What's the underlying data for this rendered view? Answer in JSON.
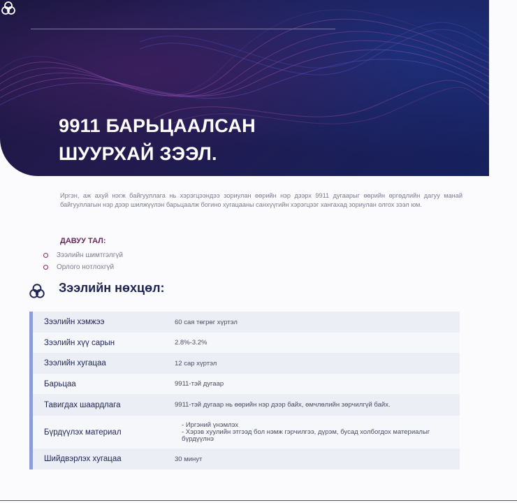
{
  "title_line1": "9911 БАРЬЦААЛСАН",
  "title_line2": "ШУУРХАЙ ЗЭЭЛ.",
  "intro": "Иргэн, аж ахуй нэгж байгууллага нь хэрэгцээндээ зориулан өөрийн нэр дээрх 9911 дугаарыг өөрийн өргөдлийн дагуу манай байгууллагын нэр дээр шилжүүлэн барьцаалж богино хугацааны санхүүгийн хэрэгцээг хангахад зориулан олгох зээл юм.",
  "advantages": {
    "heading": "ДАВУУ ТАЛ:",
    "items": [
      "Зээлийн шимтгэлгүй",
      "Орлого нотлохгүй"
    ]
  },
  "conditions": {
    "heading": "Зээлийн нөхцөл:",
    "rows": [
      {
        "label": "Зээлийн хэмжээ",
        "value": "60 сая төгрөг хүртэл"
      },
      {
        "label": "Зээлийн хүү сарын",
        "value": "2.8%-3.2%"
      },
      {
        "label": "Зээлийн хугацаа",
        "value": "12 сар хүртэл"
      },
      {
        "label": "Барьцаа",
        "value": "9911-тэй дугаар"
      },
      {
        "label": "Тавигдах шаардлага",
        "value": "9911-тэй дугаар нь өөрийн нэр дээр байх, өмчлөлийн зөрчилгүй байх."
      },
      {
        "label": "Бүрдүүлэх материал",
        "list": [
          "Иргэний үнэмлэх",
          "Хэрэв хуулийн этгээд бол нэмж гэрчилгээ, дүрэм, бусад холбогдох материалыг бүрдүүлнэ"
        ]
      },
      {
        "label": "Шийдвэрлэх хугацаа",
        "value": "30 минут"
      }
    ]
  },
  "colors": {
    "hero_dark": "#1a1740",
    "accent_magenta": "#8b2a6b",
    "navy": "#1e2452",
    "table_bar": "#8d9fd2"
  }
}
